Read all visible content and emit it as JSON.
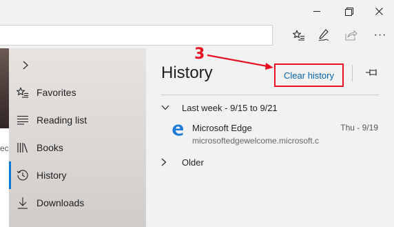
{
  "toolbar": {
    "favorites_icon": "star-list-icon",
    "notes_icon": "pen-icon",
    "share_icon": "share-icon",
    "more_label": "···"
  },
  "page": {
    "partial_text": "ec"
  },
  "hub": {
    "expand_icon": "chevron-right-icon",
    "items": [
      {
        "label": "Favorites",
        "icon": "star-list-icon"
      },
      {
        "label": "Reading list",
        "icon": "reading-list-icon"
      },
      {
        "label": "Books",
        "icon": "books-icon"
      },
      {
        "label": "History",
        "icon": "history-icon",
        "active": true
      },
      {
        "label": "Downloads",
        "icon": "download-icon"
      }
    ]
  },
  "history": {
    "title": "History",
    "clear_label": "Clear history",
    "groups": [
      {
        "label": "Last week - 9/15 to 9/21",
        "expanded": true,
        "entries": [
          {
            "title": "Microsoft Edge",
            "url": "microsoftedgewelcome.microsoft.c",
            "date": "Thu - 9/19",
            "icon": "edge-icon"
          }
        ]
      },
      {
        "label": "Older",
        "expanded": false
      }
    ]
  },
  "annotation": {
    "step": "3"
  },
  "colors": {
    "accent": "#0078d7",
    "link": "#0063b1",
    "highlight": "#e81123"
  }
}
